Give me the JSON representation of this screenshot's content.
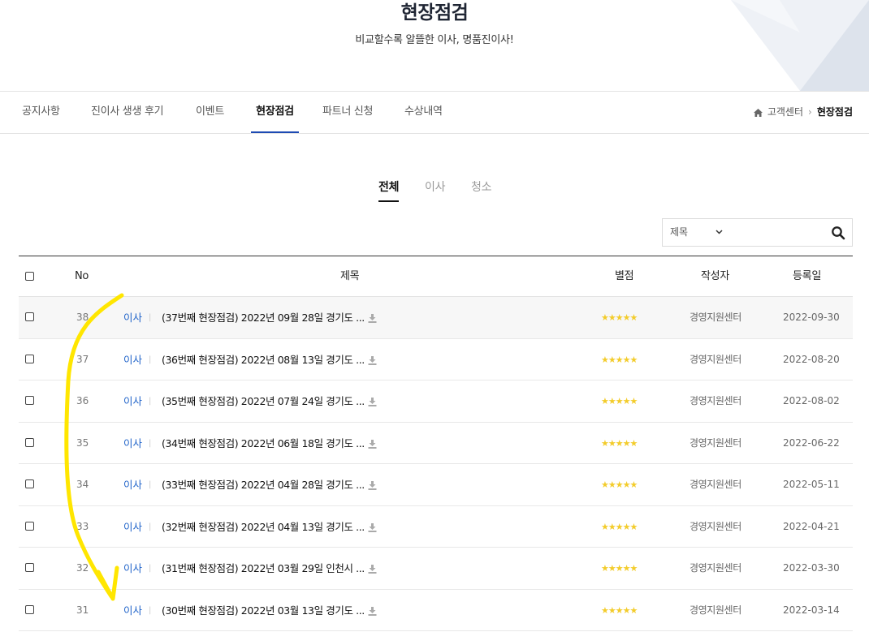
{
  "hero": {
    "title": "현장점검",
    "subtitle": "비교할수록 알뜰한 이사, 명품진이사!"
  },
  "subnav": {
    "tabs": [
      {
        "label": "공지사항"
      },
      {
        "label": "진이사 생생 후기"
      },
      {
        "label": "이벤트"
      },
      {
        "label": "현장점검",
        "active": true
      },
      {
        "label": "파트너 신청"
      },
      {
        "label": "수상내역"
      }
    ]
  },
  "breadcrumb": {
    "parent": "고객센터",
    "current": "현장점검"
  },
  "category_tabs": [
    {
      "label": "전체",
      "active": true
    },
    {
      "label": "이사"
    },
    {
      "label": "청소"
    }
  ],
  "search": {
    "field_label": "제목",
    "value": ""
  },
  "table": {
    "headers": {
      "no": "No",
      "title": "제목",
      "rating": "별점",
      "writer": "작성자",
      "date": "등록일"
    },
    "rows": [
      {
        "no": "38",
        "category": "이사",
        "title": "(37번째 현장점검) 2022년 09월 28일 경기도 ...",
        "stars": "★★★★★",
        "writer": "경영지원센터",
        "date": "2022-09-30"
      },
      {
        "no": "37",
        "category": "이사",
        "title": "(36번째 현장점검) 2022년 08월 13일 경기도 ...",
        "stars": "★★★★★",
        "writer": "경영지원센터",
        "date": "2022-08-20"
      },
      {
        "no": "36",
        "category": "이사",
        "title": "(35번째 현장점검) 2022년 07월 24일 경기도 ...",
        "stars": "★★★★★",
        "writer": "경영지원센터",
        "date": "2022-08-02"
      },
      {
        "no": "35",
        "category": "이사",
        "title": "(34번째 현장점검) 2022년 06월 18일 경기도 ...",
        "stars": "★★★★★",
        "writer": "경영지원센터",
        "date": "2022-06-22"
      },
      {
        "no": "34",
        "category": "이사",
        "title": "(33번째 현장점검) 2022년 04월 28일 경기도 ...",
        "stars": "★★★★★",
        "writer": "경영지원센터",
        "date": "2022-05-11"
      },
      {
        "no": "33",
        "category": "이사",
        "title": "(32번째 현장점검) 2022년 04월 13일 경기도 ...",
        "stars": "★★★★★",
        "writer": "경영지원센터",
        "date": "2022-04-21"
      },
      {
        "no": "32",
        "category": "이사",
        "title": "(31번째 현장점검) 2022년 03월 29일 인천시 ...",
        "stars": "★★★★★",
        "writer": "경영지원센터",
        "date": "2022-03-30"
      },
      {
        "no": "31",
        "category": "이사",
        "title": "(30번째 현장점검) 2022년 03월 13일 경기도 ...",
        "stars": "★★★★★",
        "writer": "경영지원센터",
        "date": "2022-03-14"
      }
    ]
  },
  "colors": {
    "accent_blue": "#1f63c9",
    "tab_underline": "#1d4ab3",
    "star": "#f3cc2b",
    "annotation_arrow": "#ffe600"
  }
}
